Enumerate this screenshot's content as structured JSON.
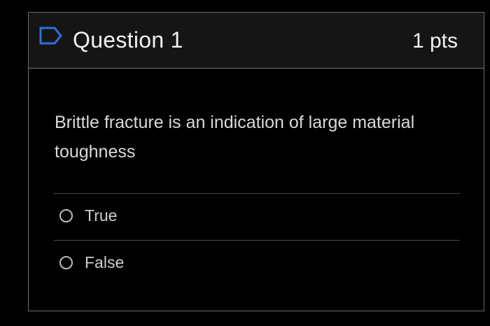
{
  "question": {
    "title": "Question 1",
    "points": "1 pts",
    "flag_icon": "bookmark-flag-icon",
    "text": "Brittle fracture is an indication of large material toughness"
  },
  "answers": [
    {
      "label": "True",
      "selected": false
    },
    {
      "label": "False",
      "selected": false
    }
  ],
  "colors": {
    "background": "#000000",
    "header_background": "#151515",
    "border": "#6b6b6b",
    "text": "#d9d9d9"
  }
}
